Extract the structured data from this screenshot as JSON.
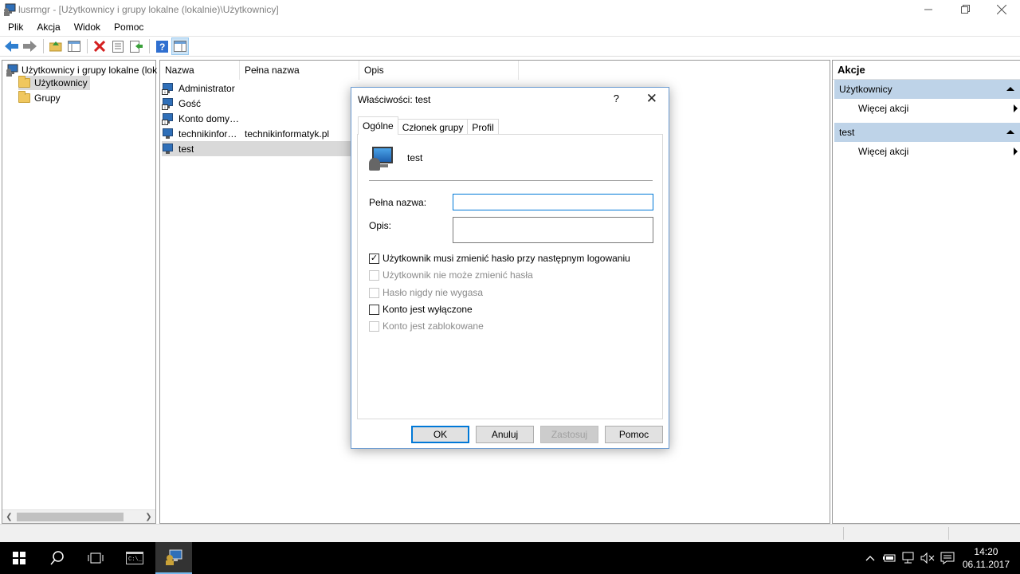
{
  "window": {
    "title": "lusrmgr - [Użytkownicy i grupy lokalne (lokalnie)\\Użytkownicy]",
    "minimize_icon": "minimize-icon",
    "restore_icon": "restore-icon",
    "close_icon": "close-icon"
  },
  "menu": [
    "Plik",
    "Akcja",
    "Widok",
    "Pomoc"
  ],
  "toolbar": [
    "back-icon",
    "forward-icon",
    "up-folder-icon",
    "show-hide-tree-icon",
    "delete-icon",
    "properties-icon",
    "export-icon",
    "help-icon",
    "show-hide-action-pane-icon"
  ],
  "tree": {
    "root": "Użytkownicy i grupy lokalne (lok",
    "items": [
      "Użytkownicy",
      "Grupy"
    ]
  },
  "list": {
    "columns": [
      "Nazwa",
      "Pełna nazwa",
      "Opis"
    ],
    "rows": [
      {
        "name": "Administrator",
        "full": ""
      },
      {
        "name": "Gość",
        "full": ""
      },
      {
        "name": "Konto domy…",
        "full": ""
      },
      {
        "name": "technikinfor…",
        "full": "technikinformatyk.pl"
      },
      {
        "name": "test",
        "full": ""
      }
    ]
  },
  "actions": {
    "title": "Akcje",
    "groups": [
      {
        "label": "Użytkownicy",
        "item": "Więcej akcji"
      },
      {
        "label": "test",
        "item": "Więcej akcji"
      }
    ]
  },
  "dialog": {
    "title": "Właściwości: test",
    "help": "?",
    "close": "✕",
    "tabs": [
      "Ogólne",
      "Członek grupy",
      "Profil"
    ],
    "username": "test",
    "full_name_label": "Pełna nazwa:",
    "full_name_value": "",
    "desc_label": "Opis:",
    "desc_value": "",
    "checkboxes": [
      {
        "label": "Użytkownik musi zmienić hasło przy następnym logowaniu",
        "checked": true,
        "disabled": false
      },
      {
        "label": "Użytkownik nie może zmienić hasła",
        "checked": false,
        "disabled": true
      },
      {
        "label": "Hasło nigdy nie wygasa",
        "checked": false,
        "disabled": true
      },
      {
        "label": "Konto jest wyłączone",
        "checked": false,
        "disabled": false
      },
      {
        "label": "Konto jest zablokowane",
        "checked": false,
        "disabled": true
      }
    ],
    "buttons": {
      "ok": "OK",
      "cancel": "Anuluj",
      "apply": "Zastosuj",
      "help": "Pomoc"
    }
  },
  "taskbar": {
    "time": "14:20",
    "date": "06.11.2017"
  }
}
